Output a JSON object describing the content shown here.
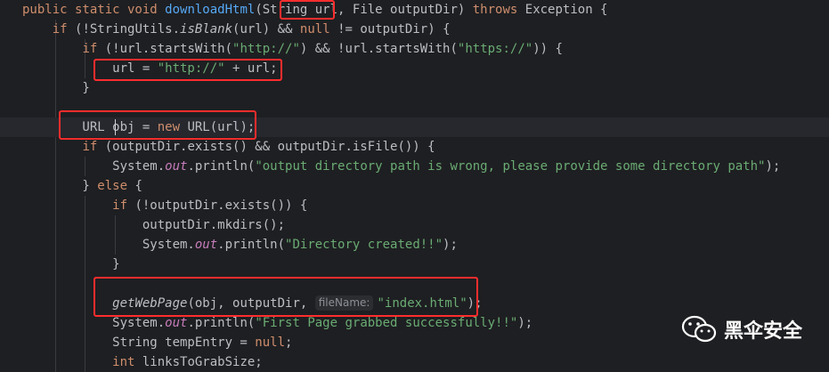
{
  "code_lines": [
    {
      "tokens": [
        {
          "t": "public static void ",
          "c": "kw"
        },
        {
          "t": "downloadHtml",
          "c": "fn"
        },
        {
          "t": "(String url, File outputDir) ",
          "c": "plain"
        },
        {
          "t": "throws ",
          "c": "kw"
        },
        {
          "t": "Exception {",
          "c": "plain"
        }
      ]
    },
    {
      "tokens": [
        {
          "t": "    "
        },
        {
          "t": "if ",
          "c": "kw"
        },
        {
          "t": "(!StringUtils.",
          "c": "plain"
        },
        {
          "t": "isBlank",
          "c": "ital"
        },
        {
          "t": "(url) && ",
          "c": "plain"
        },
        {
          "t": "null ",
          "c": "kw"
        },
        {
          "t": "!= outputDir) {",
          "c": "plain"
        }
      ]
    },
    {
      "tokens": [
        {
          "t": "        "
        },
        {
          "t": "if ",
          "c": "kw"
        },
        {
          "t": "(!url.startsWith(",
          "c": "plain"
        },
        {
          "t": "\"http://\"",
          "c": "str"
        },
        {
          "t": ") && !url.startsWith(",
          "c": "plain"
        },
        {
          "t": "\"https://\"",
          "c": "str"
        },
        {
          "t": ")) {",
          "c": "plain"
        }
      ]
    },
    {
      "tokens": [
        {
          "t": "            url = ",
          "c": "plain"
        },
        {
          "t": "\"http://\"",
          "c": "str"
        },
        {
          "t": " + url;",
          "c": "plain"
        }
      ]
    },
    {
      "tokens": [
        {
          "t": "        }",
          "c": "plain"
        }
      ]
    },
    {
      "tokens": []
    },
    {
      "tokens": [
        {
          "t": "        URL obj = ",
          "c": "plain"
        },
        {
          "t": "new ",
          "c": "kw"
        },
        {
          "t": "URL(url);",
          "c": "plain"
        }
      ]
    },
    {
      "tokens": [
        {
          "t": "        "
        },
        {
          "t": "if ",
          "c": "kw"
        },
        {
          "t": "(outputDir.exists() && outputDir.isFile()) {",
          "c": "plain"
        }
      ]
    },
    {
      "tokens": [
        {
          "t": "            System.",
          "c": "plain"
        },
        {
          "t": "out",
          "c": "fld"
        },
        {
          "t": ".println(",
          "c": "plain"
        },
        {
          "t": "\"output directory path is wrong, please provide some directory path\"",
          "c": "str"
        },
        {
          "t": ");",
          "c": "plain"
        }
      ]
    },
    {
      "tokens": [
        {
          "t": "        } ",
          "c": "plain"
        },
        {
          "t": "else ",
          "c": "kw"
        },
        {
          "t": "{",
          "c": "plain"
        }
      ]
    },
    {
      "tokens": [
        {
          "t": "            "
        },
        {
          "t": "if ",
          "c": "kw"
        },
        {
          "t": "(!outputDir.exists()) {",
          "c": "plain"
        }
      ]
    },
    {
      "tokens": [
        {
          "t": "                outputDir.mkdirs();",
          "c": "plain"
        }
      ]
    },
    {
      "tokens": [
        {
          "t": "                System.",
          "c": "plain"
        },
        {
          "t": "out",
          "c": "fld"
        },
        {
          "t": ".println(",
          "c": "plain"
        },
        {
          "t": "\"Directory created!!\"",
          "c": "str"
        },
        {
          "t": ");",
          "c": "plain"
        }
      ]
    },
    {
      "tokens": [
        {
          "t": "            }",
          "c": "plain"
        }
      ]
    },
    {
      "tokens": []
    },
    {
      "tokens": [
        {
          "t": "            "
        },
        {
          "t": "getWebPage",
          "c": "ital"
        },
        {
          "t": "(obj, outputDir, ",
          "c": "plain"
        },
        {
          "t": "fileName:",
          "c": "hint"
        },
        {
          "t": "\"index.html\"",
          "c": "str"
        },
        {
          "t": ");",
          "c": "plain"
        }
      ]
    },
    {
      "tokens": [
        {
          "t": "            System.",
          "c": "plain"
        },
        {
          "t": "out",
          "c": "fld"
        },
        {
          "t": ".println(",
          "c": "plain"
        },
        {
          "t": "\"First Page grabbed successfully!!\"",
          "c": "str"
        },
        {
          "t": ");",
          "c": "plain"
        }
      ]
    },
    {
      "tokens": [
        {
          "t": "            String tempEntry = ",
          "c": "plain"
        },
        {
          "t": "null",
          "c": "kw"
        },
        {
          "t": ";",
          "c": "plain"
        }
      ]
    },
    {
      "tokens": [
        {
          "t": "            "
        },
        {
          "t": "int ",
          "c": "kw"
        },
        {
          "t": "linksToGrabSize;",
          "c": "plain"
        }
      ]
    }
  ],
  "current_line": 6,
  "watermark": {
    "text": "黑伞安全",
    "icon": "wechat-icon"
  },
  "colors": {
    "background": "#1e1f22",
    "keyword": "#cf8e6d",
    "method": "#56a8f5",
    "string": "#6aab73",
    "field": "#c77dbb",
    "highlight_box": "#ff2d2d"
  }
}
